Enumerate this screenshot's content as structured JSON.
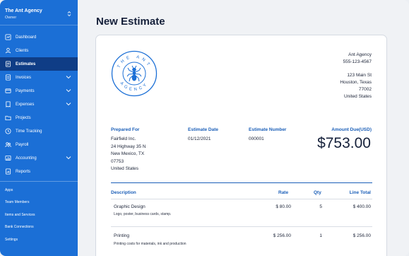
{
  "brand": {
    "name": "The Ant Agency",
    "role": "Owner"
  },
  "nav": {
    "dashboard": "Dashboard",
    "clients": "Clients",
    "estimates": "Estimates",
    "invoices": "Invoices",
    "payments": "Payments",
    "expenses": "Expenses",
    "projects": "Projects",
    "time_tracking": "Time Tracking",
    "payroll": "Payroll",
    "accounting": "Accounting",
    "reports": "Reports"
  },
  "sub_nav": {
    "apps": "Apps",
    "team_members": "Team Members",
    "items_services": "Items and Services",
    "bank_connections": "Bank Connections",
    "settings": "Settings"
  },
  "page": {
    "title": "New Estimate"
  },
  "logo": {
    "top_text": "THE ANT",
    "bottom_text": "AGENCY"
  },
  "company": {
    "name": "Ant Agency",
    "phone": "555-123-4567",
    "street": "123 Main St",
    "city_state": "Houston, Texas",
    "zip": "77002",
    "country": "United States"
  },
  "estimate": {
    "prepared_for_label": "Prepared For",
    "client_name": "Fairfield Inc.",
    "client_street": "24 Highway 35 N",
    "client_city_state": "New Mexico, TX",
    "client_zip": "07753",
    "client_country": "United States",
    "date_label": "Estimate Date",
    "date": "01/12/2021",
    "number_label": "Estimate Number",
    "number": "000001",
    "amount_due_label": "Amount Due(USD)",
    "amount_due": "$753.00"
  },
  "table": {
    "headers": {
      "description": "Description",
      "rate": "Rate",
      "qty": "Qty",
      "line_total": "Line Total"
    },
    "rows": [
      {
        "description": "Graphic Design",
        "detail": "Logo, poster, business cards, stamp.",
        "rate": "$ 80.00",
        "qty": "5",
        "total": "$ 400.00"
      },
      {
        "description": "Printing",
        "detail": "Printing costs for materials, ink and production",
        "rate": "$ 256.00",
        "qty": "1",
        "total": "$ 256.00"
      }
    ]
  },
  "colors": {
    "sidebar": "#1b6fd6",
    "sidebar_active": "#0f3d86",
    "accent": "#1b5fb8"
  }
}
